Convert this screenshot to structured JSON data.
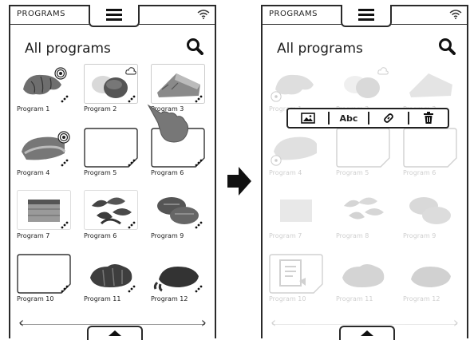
{
  "left_screen": {
    "status_label": "PROGRAMS",
    "title": "All programs",
    "programs": [
      {
        "label": "Program 1",
        "art": "croissant",
        "badge": "target-icon"
      },
      {
        "label": "Program 2",
        "art": "bread-bun",
        "badge": "cloud-icon"
      },
      {
        "label": "Program 3",
        "art": "bread-loaf",
        "badge": ""
      },
      {
        "label": "Program 4",
        "art": "loaf-slice",
        "badge": "target-icon"
      },
      {
        "label": "Program 5",
        "art": "empty",
        "badge": ""
      },
      {
        "label": "Program 6",
        "art": "empty",
        "badge": ""
      },
      {
        "label": "Program 7",
        "art": "cake",
        "badge": ""
      },
      {
        "label": "Program 6",
        "art": "prawns",
        "badge": ""
      },
      {
        "label": "Program 9",
        "art": "burgers",
        "badge": ""
      },
      {
        "label": "Program 10",
        "art": "empty",
        "badge": ""
      },
      {
        "label": "Program 11",
        "art": "meat",
        "badge": ""
      },
      {
        "label": "Program 12",
        "art": "chicken",
        "badge": ""
      }
    ]
  },
  "right_screen": {
    "status_label": "PROGRAMS",
    "title": "All programs",
    "context_menu": {
      "text_label": "Abc"
    },
    "programs": [
      {
        "label": "Program 1"
      },
      {
        "label": "Program 2"
      },
      {
        "label": "Program 3"
      },
      {
        "label": "Program 4"
      },
      {
        "label": "Program 5"
      },
      {
        "label": "Program 6"
      },
      {
        "label": "Program 7"
      },
      {
        "label": "Program 8"
      },
      {
        "label": "Program 9"
      },
      {
        "label": "Program 10"
      },
      {
        "label": "Program 11"
      },
      {
        "label": "Program 12"
      }
    ]
  },
  "nav": {
    "prev": "‹",
    "next": "›"
  }
}
